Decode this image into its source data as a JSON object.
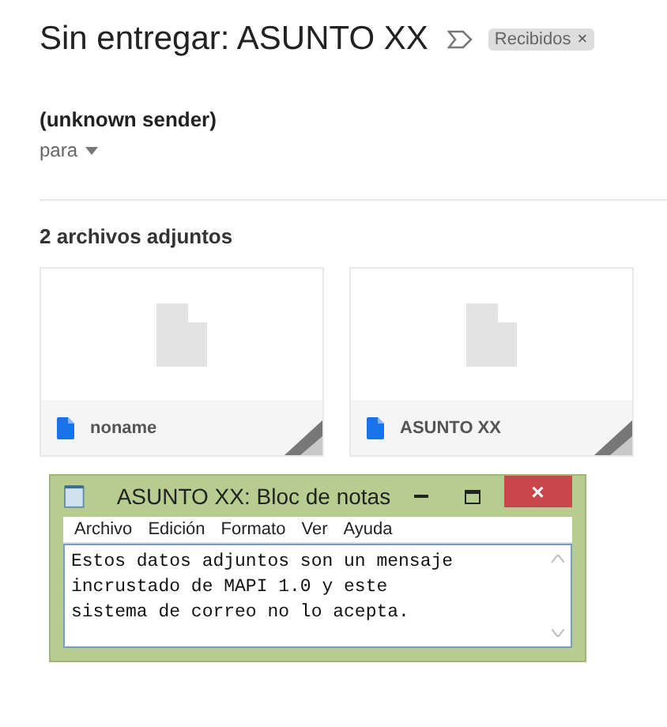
{
  "email": {
    "subject": "Sin entregar: ASUNTO XX",
    "label": {
      "text": "Recibidos",
      "close": "×"
    },
    "sender": "(unknown sender)",
    "recipient": "para"
  },
  "attachments": {
    "heading": "2 archivos adjuntos",
    "items": [
      {
        "name": "noname"
      },
      {
        "name": "ASUNTO XX"
      }
    ]
  },
  "notepad": {
    "title": "ASUNTO XX: Bloc de notas",
    "close": "×",
    "menu": [
      "Archivo",
      "Edición",
      "Formato",
      "Ver",
      "Ayuda"
    ],
    "lines": [
      "Estos datos adjuntos son un mensaje",
      "incrustado de MAPI 1.0 y este",
      "sistema de correo no lo acepta."
    ]
  }
}
